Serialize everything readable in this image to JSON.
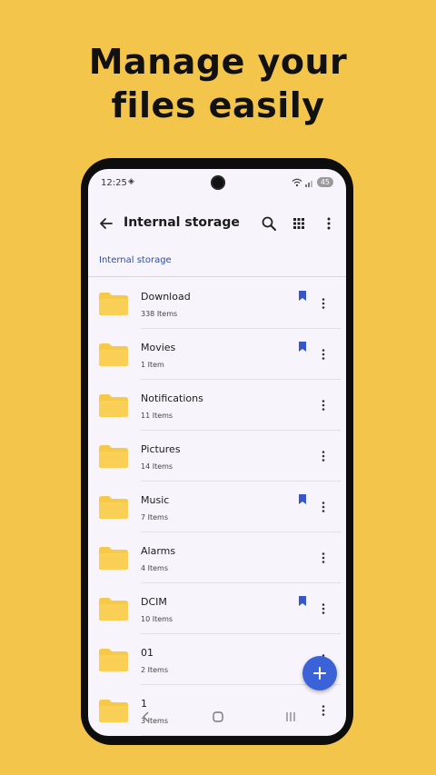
{
  "promo": {
    "line1": "Manage your",
    "line2": "files easily"
  },
  "status_bar": {
    "time": "12:25",
    "battery": "45"
  },
  "app_bar": {
    "title": "Internal storage"
  },
  "breadcrumb": "Internal storage",
  "folders": [
    {
      "name": "Download",
      "count": "338 Items",
      "bookmarked": true
    },
    {
      "name": "Movies",
      "count": "1 Item",
      "bookmarked": true
    },
    {
      "name": "Notifications",
      "count": "11 Items",
      "bookmarked": false
    },
    {
      "name": "Pictures",
      "count": "14 Items",
      "bookmarked": false
    },
    {
      "name": "Music",
      "count": "7 Items",
      "bookmarked": true
    },
    {
      "name": "Alarms",
      "count": "4 Items",
      "bookmarked": false
    },
    {
      "name": "DCIM",
      "count": "10 Items",
      "bookmarked": true
    },
    {
      "name": "01",
      "count": "2 Items",
      "bookmarked": false
    },
    {
      "name": "1",
      "count": "3 Items",
      "bookmarked": false
    }
  ],
  "colors": {
    "background": "#F3C54B",
    "accent": "#3C62D8",
    "folder": "#F7C948",
    "bookmark": "#3557C8"
  },
  "icons": [
    "back-arrow-icon",
    "search-icon",
    "grid-view-icon",
    "more-vert-icon",
    "folder-icon",
    "bookmark-icon",
    "plus-icon"
  ]
}
